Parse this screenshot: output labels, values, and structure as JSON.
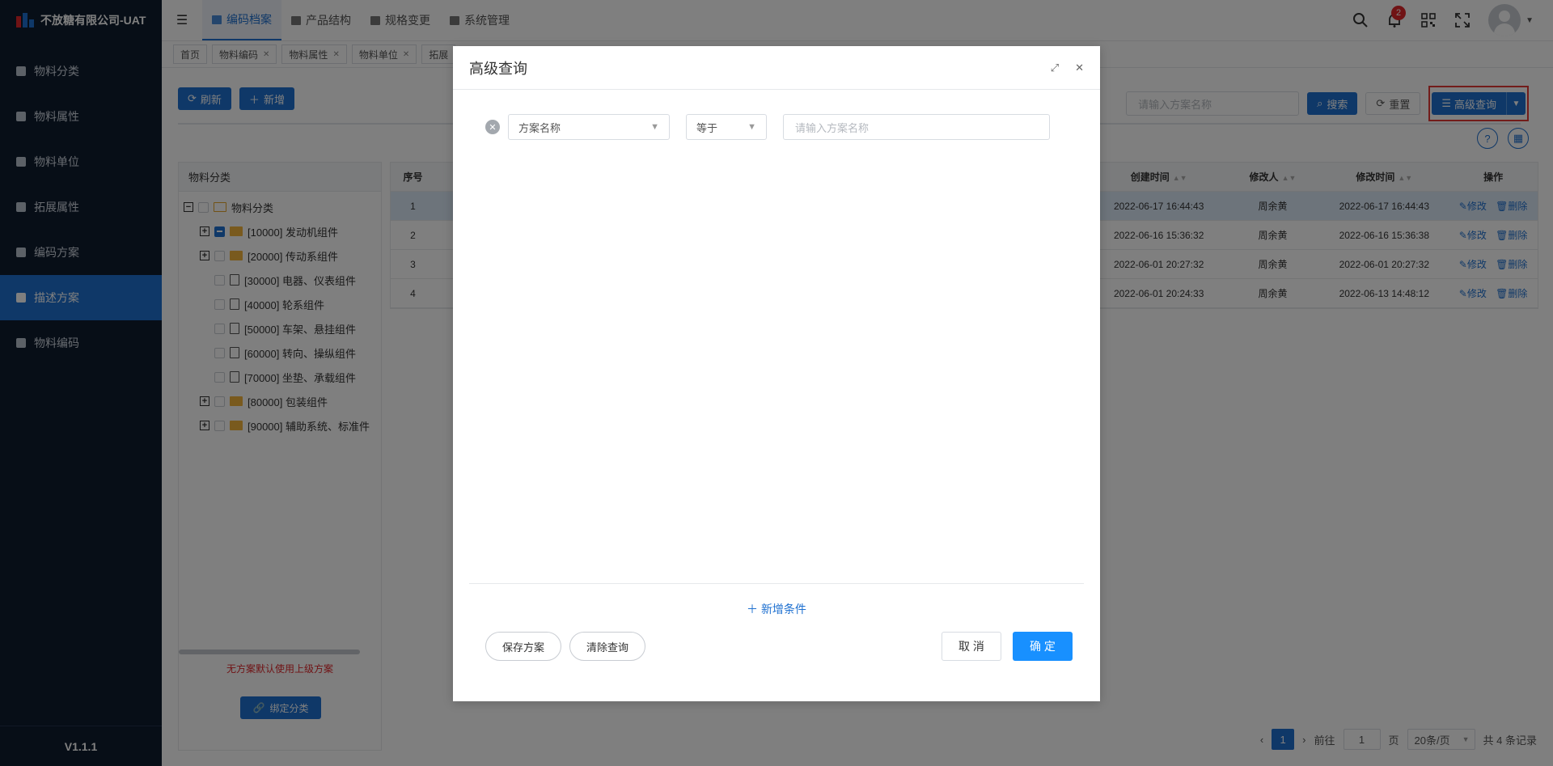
{
  "app": {
    "name": "不放糖有限公司-UAT",
    "version": "V1.1.1"
  },
  "sidebar": {
    "items": [
      {
        "label": "物料分类",
        "icon": "grid-icon",
        "active": false
      },
      {
        "label": "物料属性",
        "icon": "info-icon",
        "active": false
      },
      {
        "label": "物料单位",
        "icon": "pen-icon",
        "active": false
      },
      {
        "label": "拓展属性",
        "icon": "image-icon",
        "active": false
      },
      {
        "label": "编码方案",
        "icon": "book-icon",
        "active": false
      },
      {
        "label": "描述方案",
        "icon": "monitor-icon",
        "active": true
      },
      {
        "label": "物料编码",
        "icon": "file-icon",
        "active": false
      }
    ]
  },
  "topnav": {
    "tabs": [
      {
        "label": "编码档案",
        "active": true
      },
      {
        "label": "产品结构",
        "active": false
      },
      {
        "label": "规格变更",
        "active": false
      },
      {
        "label": "系统管理",
        "active": false
      }
    ],
    "notification_count": "2"
  },
  "breadcrumb_tabs": [
    {
      "label": "首页",
      "closable": false
    },
    {
      "label": "物料编码",
      "closable": true
    },
    {
      "label": "物料属性",
      "closable": true
    },
    {
      "label": "物料单位",
      "closable": true
    },
    {
      "label": "拓展",
      "closable": false
    }
  ],
  "toolbar": {
    "refresh": "刷新",
    "add": "新增"
  },
  "search": {
    "placeholder": "请输入方案名称",
    "search": "搜索",
    "reset": "重置",
    "advanced": "高级查询"
  },
  "tree": {
    "header": "物料分类",
    "root": "物料分类",
    "nodes": [
      {
        "label": "[10000] 发动机组件",
        "expandable": true,
        "type": "folder",
        "check": "indeterminate"
      },
      {
        "label": "[20000] 传动系组件",
        "expandable": true,
        "type": "folder",
        "check": "none"
      },
      {
        "label": "[30000] 电器、仪表组件",
        "expandable": false,
        "type": "doc",
        "check": "none"
      },
      {
        "label": "[40000] 轮系组件",
        "expandable": false,
        "type": "doc",
        "check": "none"
      },
      {
        "label": "[50000] 车架、悬挂组件",
        "expandable": false,
        "type": "doc",
        "check": "none"
      },
      {
        "label": "[60000] 转向、操纵组件",
        "expandable": false,
        "type": "doc",
        "check": "none"
      },
      {
        "label": "[70000] 坐垫、承载组件",
        "expandable": false,
        "type": "doc",
        "check": "none"
      },
      {
        "label": "[80000] 包装组件",
        "expandable": true,
        "type": "folder",
        "check": "none"
      },
      {
        "label": "[90000] 辅助系统、标准件",
        "expandable": true,
        "type": "folder",
        "check": "none"
      }
    ],
    "tip": "无方案默认使用上级方案",
    "bind_button": "绑定分类"
  },
  "table": {
    "columns": {
      "index": "序号",
      "created": "创建时间",
      "modifier": "修改人",
      "modified": "修改时间",
      "ops": "操作"
    },
    "rows": [
      {
        "index": "1",
        "created": "2022-06-17 16:44:43",
        "modifier": "周余黄",
        "modified": "2022-06-17 16:44:43",
        "selected": true
      },
      {
        "index": "2",
        "created": "2022-06-16 15:36:32",
        "modifier": "周余黄",
        "modified": "2022-06-16 15:36:38",
        "selected": false
      },
      {
        "index": "3",
        "created": "2022-06-01 20:27:32",
        "modifier": "周余黄",
        "modified": "2022-06-01 20:27:32",
        "selected": false
      },
      {
        "index": "4",
        "created": "2022-06-01 20:24:33",
        "modifier": "周余黄",
        "modified": "2022-06-13 14:48:12",
        "selected": false
      }
    ],
    "edit": "修改",
    "delete": "删除"
  },
  "pager": {
    "current": "1",
    "goto_prefix": "前往",
    "goto_value": "1",
    "goto_suffix": "页",
    "page_size": "20条/页",
    "total": "共 4 条记录"
  },
  "modal": {
    "title": "高级查询",
    "field_select": "方案名称",
    "operator_select": "等于",
    "value_placeholder": "请输入方案名称",
    "add_condition": "新增条件",
    "save_plan": "保存方案",
    "clear_query": "清除查询",
    "cancel": "取 消",
    "confirm": "确 定"
  },
  "colors": {
    "sidebar_bg": "#0f1c2e",
    "primary": "#1e70d0",
    "confirm": "#1890ff",
    "highlight_border": "#e53935"
  }
}
